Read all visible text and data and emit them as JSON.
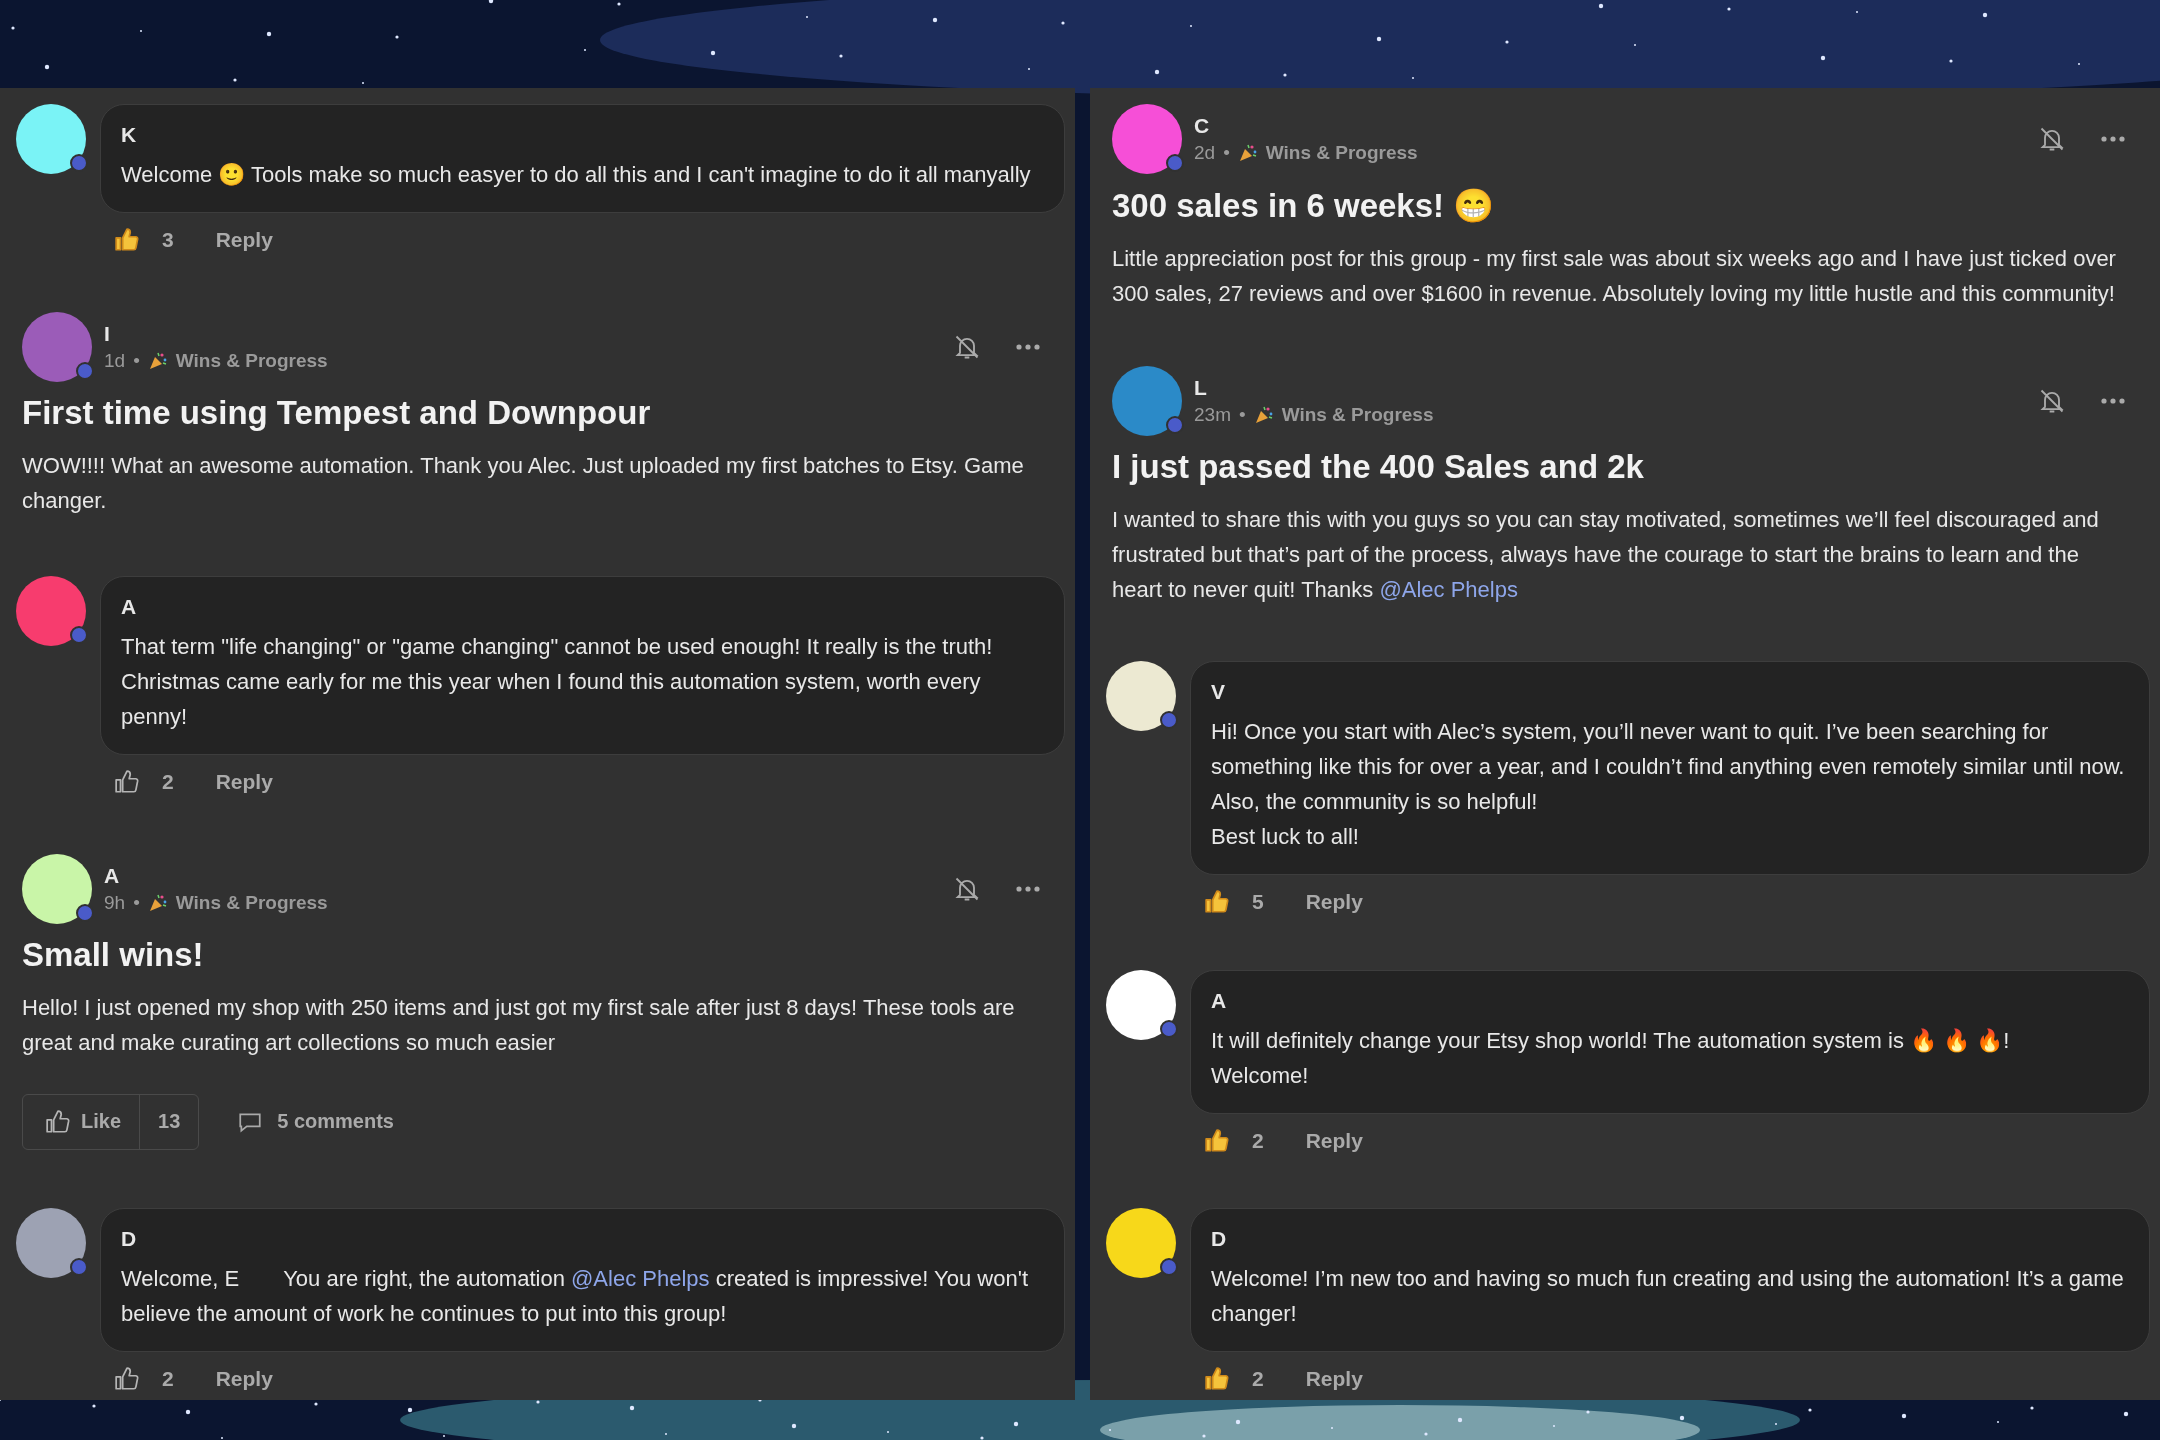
{
  "columns": [
    {
      "items": [
        {
          "kind": "comment",
          "color": "#7af3f6",
          "name": "K",
          "parts": [
            {
              "kind": "text",
              "text": "Welcome 🙂 Tools make so much easyer to do all this and I can't imagine to do it all manyally"
            }
          ],
          "liked": true,
          "likes": "3",
          "reply": "Reply"
        },
        {
          "kind": "post",
          "color": "#9b5cb8",
          "name": "I",
          "time": "1d",
          "separator": "•",
          "category": "Wins & Progress",
          "title": "First time using Tempest and Downpour",
          "parts": [
            {
              "kind": "text",
              "text": "WOW!!!! What an awesome automation. Thank you Alec. Just uploaded my first batches to Etsy. Game changer."
            }
          ]
        },
        {
          "kind": "comment",
          "color": "#f73c6e",
          "name": "A",
          "parts": [
            {
              "kind": "text",
              "text": "That term \"life changing\" or \"game changing\" cannot be used enough! It really is the truth! Christmas came early for me this year when I found this automation system, worth every penny!"
            }
          ],
          "liked": false,
          "likes": "2",
          "reply": "Reply"
        },
        {
          "kind": "post",
          "color": "#c9f5a8",
          "name": "A",
          "time": "9h",
          "separator": "•",
          "category": "Wins & Progress",
          "title": "Small wins!",
          "parts": [
            {
              "kind": "text",
              "text": "Hello! I just opened my shop with 250 items and just got my first sale after just 8 days! These tools are great and make curating art collections so much easier"
            }
          ],
          "footer": {
            "like": "Like",
            "count": "13",
            "comments": "5 comments"
          }
        },
        {
          "kind": "comment",
          "color": "#9da2b3",
          "name": "D",
          "parts": [
            {
              "kind": "text",
              "text": "Welcome, E"
            },
            {
              "kind": "text",
              "text": "You are right, the automation "
            },
            {
              "kind": "mention",
              "text": "@Alec Phelps"
            },
            {
              "kind": "text",
              "text": " created is impressive! You won't believe the amount of work he continues to put into this group!"
            }
          ],
          "liked": false,
          "likes": "2",
          "reply": "Reply"
        }
      ]
    },
    {
      "items": [
        {
          "kind": "post",
          "color": "#f64fd7",
          "name": "C",
          "time": "2d",
          "separator": "•",
          "category": "Wins & Progress",
          "title": "300 sales in 6 weeks! 😁",
          "parts": [
            {
              "kind": "text",
              "text": "Little appreciation post for this group - my first sale was about six weeks ago and I have just ticked over 300 sales, 27 reviews and over $1600 in revenue. Absolutely loving my little hustle and this community!"
            }
          ]
        },
        {
          "kind": "post",
          "color": "#2b8ac8",
          "name": "L",
          "time": "23m",
          "separator": "•",
          "category": "Wins & Progress",
          "title": "I just passed the 400 Sales and 2k",
          "parts": [
            {
              "kind": "text",
              "text": "I wanted to share this with you guys so you can stay motivated, sometimes we’ll feel discouraged and frustrated but that’s part of the process, always have the courage to start the brains to learn and the heart to never quit! Thanks "
            },
            {
              "kind": "mention",
              "text": "@Alec Phelps"
            }
          ]
        },
        {
          "kind": "comment",
          "color": "#ece9d2",
          "name": "V",
          "parts": [
            {
              "kind": "text",
              "text": "Hi! Once you start with Alec’s system, you’ll never want to quit. I’ve been searching for something like this for over a year, and I couldn’t find anything even remotely similar until now.\nAlso, the community is so helpful!\nBest luck to all!"
            }
          ],
          "liked": true,
          "likes": "5",
          "reply": "Reply"
        },
        {
          "kind": "comment",
          "color": "#ffffff",
          "name": "A",
          "parts": [
            {
              "kind": "text",
              "text": "It will definitely change your Etsy shop world! The automation system is 🔥 🔥 🔥!\nWelcome!"
            }
          ],
          "liked": true,
          "likes": "2",
          "reply": "Reply"
        },
        {
          "kind": "comment",
          "color": "#f7d81a",
          "name": "D",
          "parts": [
            {
              "kind": "text",
              "text": "Welcome! I’m new too and having so much fun creating and using the automation! It’s a game changer!"
            }
          ],
          "liked": true,
          "likes": "2",
          "reply": "Reply"
        }
      ]
    }
  ]
}
